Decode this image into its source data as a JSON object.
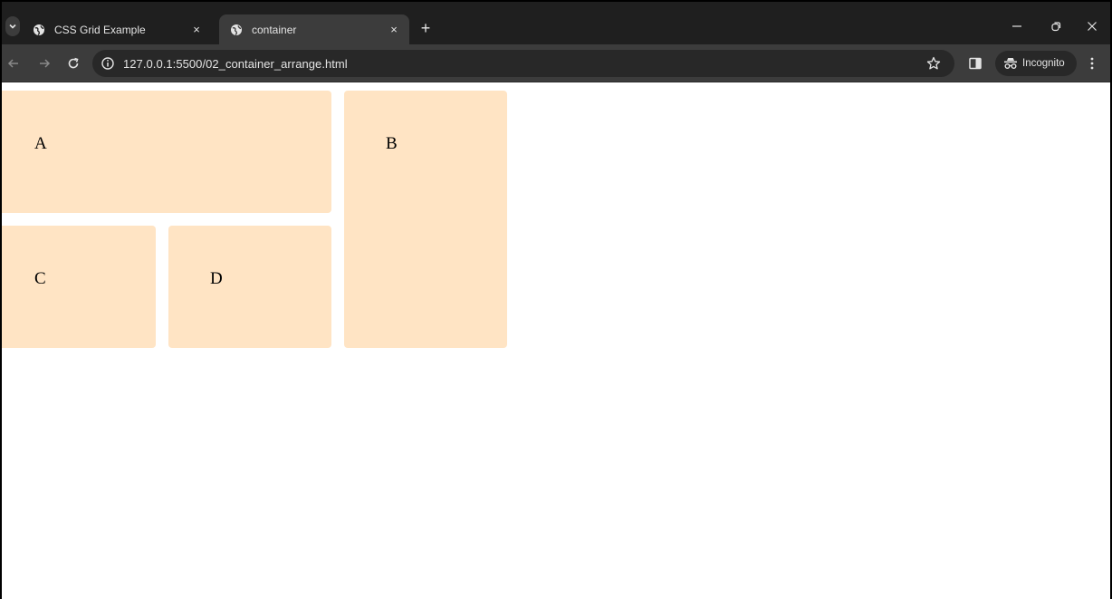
{
  "browser": {
    "tabs": [
      {
        "title": "CSS Grid Example",
        "active": false
      },
      {
        "title": "container",
        "active": true
      }
    ],
    "new_tab_glyph": "+",
    "close_glyph": "×",
    "address": "127.0.0.1:5500/02_container_arrange.html",
    "profile_label": "Incognito",
    "icons": {
      "tab_search": "chevron-down-icon",
      "back": "arrow-left-icon",
      "forward": "arrow-right-icon",
      "reload": "reload-icon",
      "site_info": "info-icon",
      "bookmark": "star-icon",
      "side_panel": "side-panel-icon",
      "incognito": "incognito-icon",
      "menu": "kebab-menu-icon",
      "minimize": "minimize-icon",
      "restore": "restore-icon",
      "close_window": "close-icon"
    },
    "colors": {
      "tabstrip": "#1f1f1f",
      "toolbar": "#3c3c3c",
      "omnibox": "#282828",
      "text": "#e3e3e3"
    }
  },
  "page": {
    "grid_items": {
      "a": "A",
      "b": "B",
      "c": "C",
      "d": "D"
    },
    "colors": {
      "item_background": "#ffe4c4",
      "page_background": "#ffffff"
    }
  }
}
